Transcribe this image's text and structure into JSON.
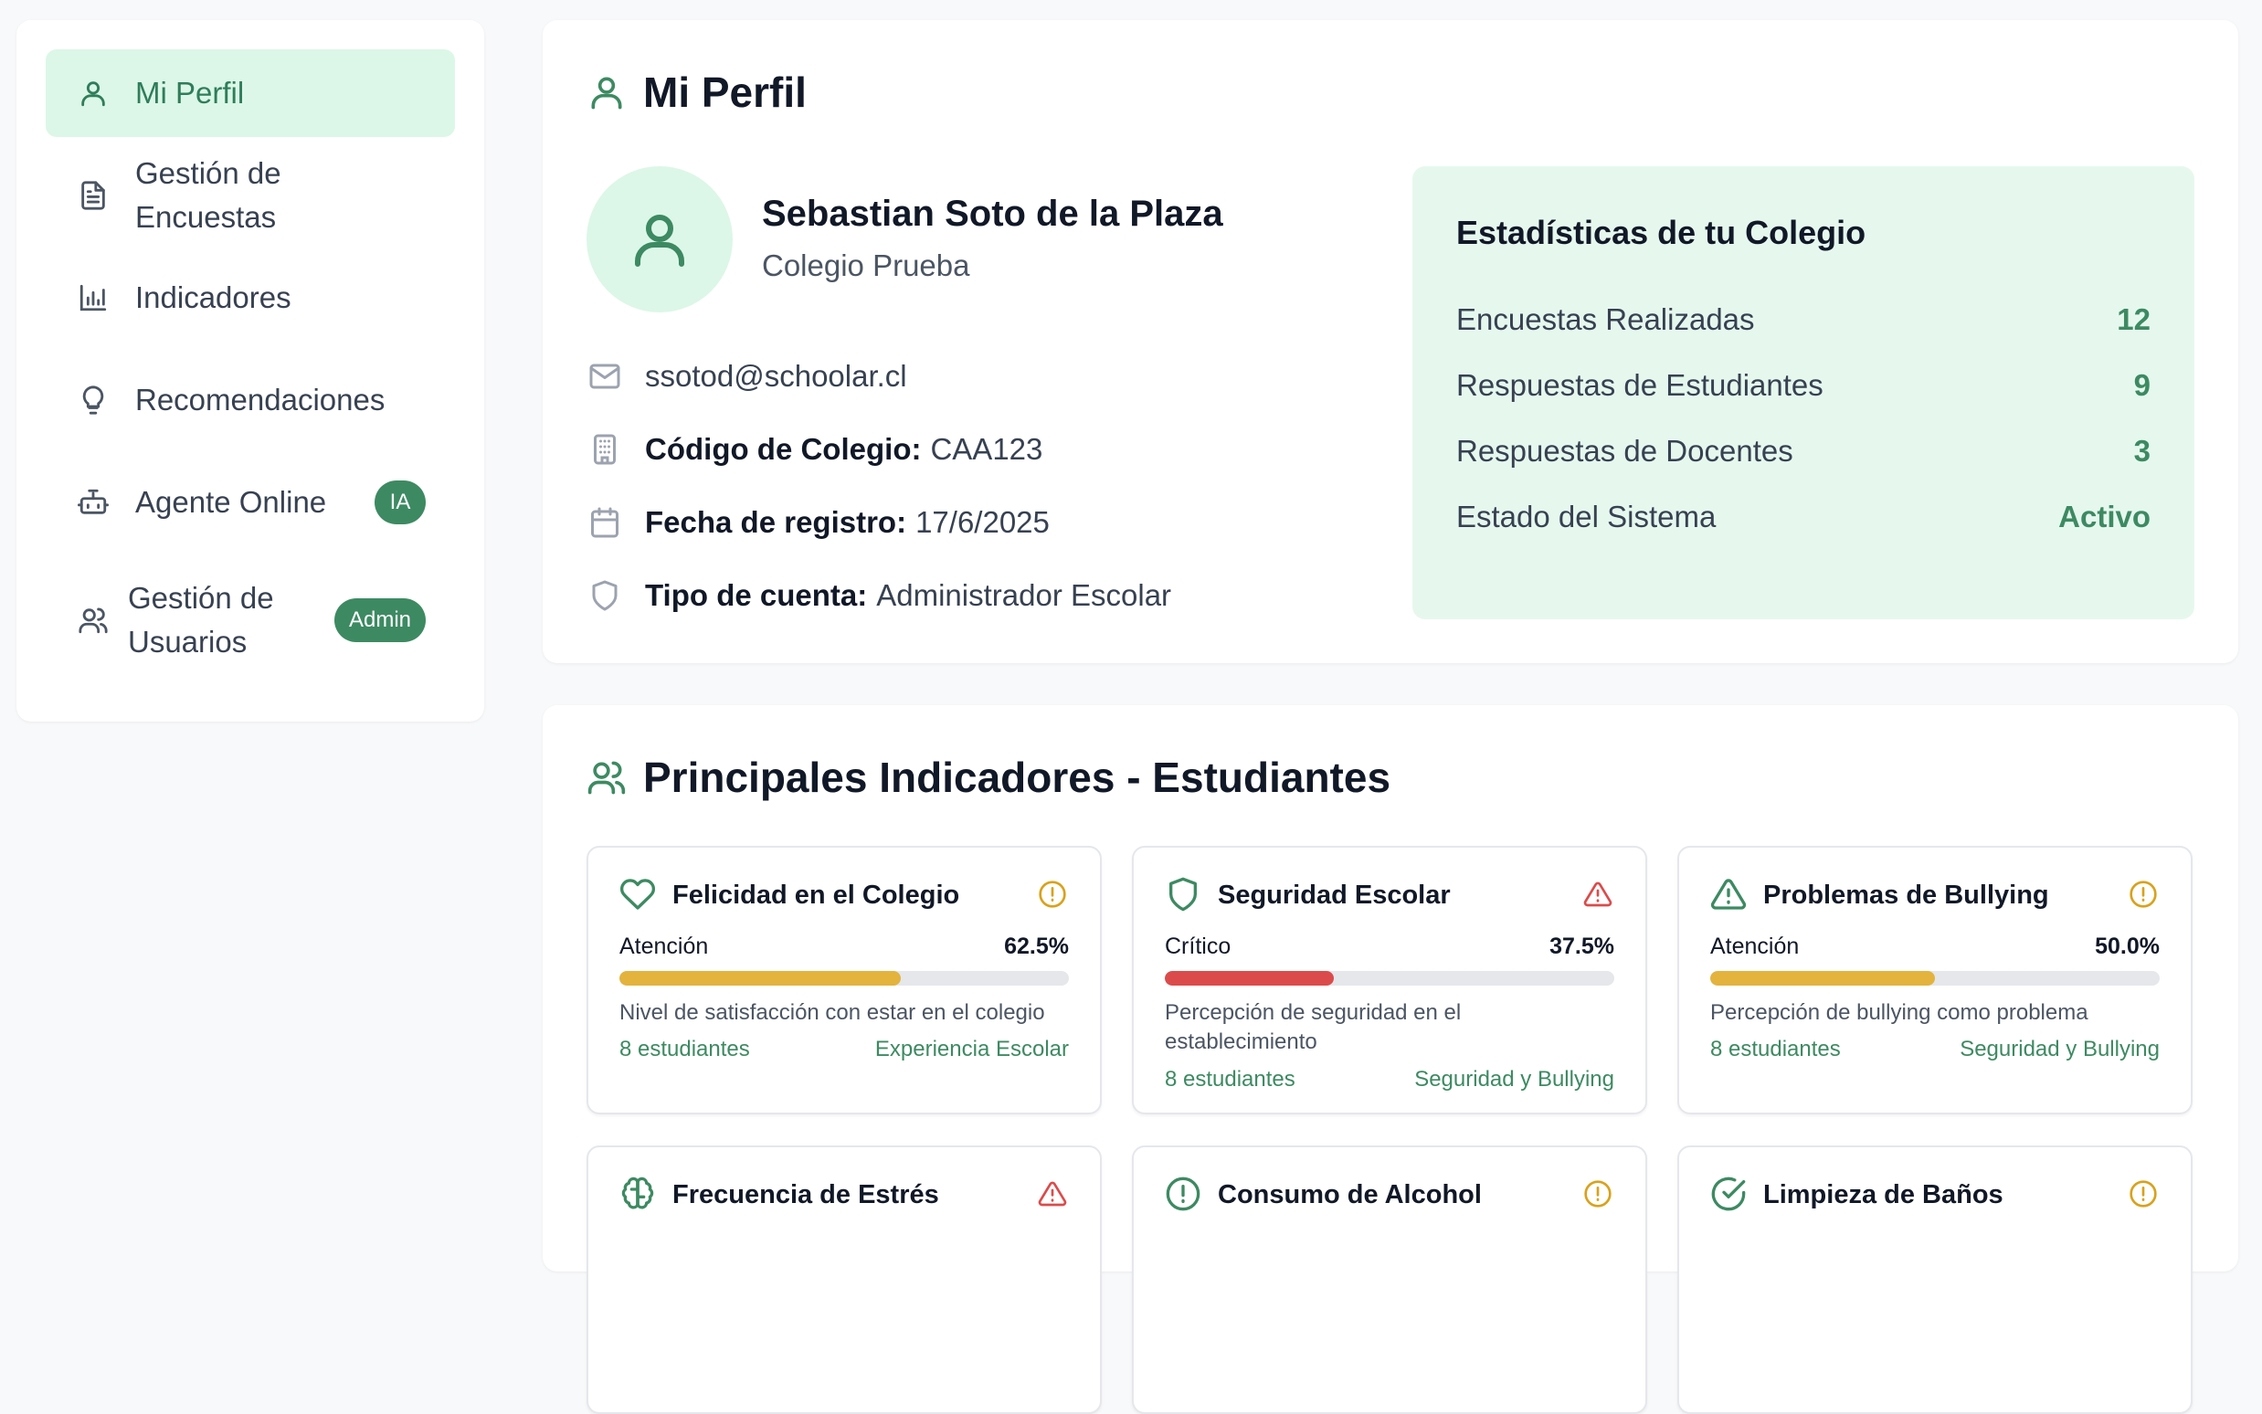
{
  "sidebar": {
    "items": [
      {
        "label": "Mi Perfil",
        "icon": "user-icon",
        "active": true
      },
      {
        "label": "Gestión de Encuestas",
        "icon": "file-text-icon"
      },
      {
        "label": "Indicadores",
        "icon": "bar-chart-icon"
      },
      {
        "label": "Recomendaciones",
        "icon": "lightbulb-icon"
      },
      {
        "label": "Agente Online",
        "icon": "bot-icon",
        "badge": "IA"
      },
      {
        "label": "Gestión de Usuarios",
        "icon": "users-icon",
        "badge": "Admin"
      }
    ]
  },
  "profile": {
    "title": "Mi Perfil",
    "name": "Sebastian Soto de la Plaza",
    "school": "Colegio Prueba",
    "email": "ssotod@schoolar.cl",
    "code_label": "Código de Colegio:",
    "code_value": "CAA123",
    "date_label": "Fecha de registro:",
    "date_value": "17/6/2025",
    "type_label": "Tipo de cuenta:",
    "type_value": "Administrador Escolar"
  },
  "stats": {
    "title": "Estadísticas de tu Colegio",
    "rows": [
      {
        "label": "Encuestas Realizadas",
        "value": "12"
      },
      {
        "label": "Respuestas de Estudiantes",
        "value": "9"
      },
      {
        "label": "Respuestas de Docentes",
        "value": "3"
      },
      {
        "label": "Estado del Sistema",
        "value": "Activo"
      }
    ]
  },
  "indicators": {
    "title": "Principales Indicadores - Estudiantes",
    "colors": {
      "warning": "#e3b33d",
      "critical": "#dc4b4b",
      "accent": "#3d8a62",
      "track": "#e5e7eb"
    },
    "cards": [
      {
        "title": "Felicidad en el Colegio",
        "icon": "heart-icon",
        "status_icon": "alert-circle-icon",
        "level": "Atención",
        "percent": "62.5%",
        "fill": 0.625,
        "severity": "warning",
        "description": "Nivel de satisfacción con estar en el colegio",
        "students": "8 estudiantes",
        "category": "Experiencia Escolar"
      },
      {
        "title": "Seguridad Escolar",
        "icon": "shield-icon",
        "status_icon": "alert-triangle-icon",
        "level": "Crítico",
        "percent": "37.5%",
        "fill": 0.375,
        "severity": "critical",
        "description": "Percepción de seguridad en el establecimiento",
        "students": "8 estudiantes",
        "category": "Seguridad y Bullying"
      },
      {
        "title": "Problemas de Bullying",
        "icon": "alert-triangle-icon",
        "status_icon": "alert-circle-icon",
        "level": "Atención",
        "percent": "50.0%",
        "fill": 0.5,
        "severity": "warning",
        "description": "Percepción de bullying como problema",
        "students": "8 estudiantes",
        "category": "Seguridad y Bullying"
      },
      {
        "title": "Frecuencia de Estrés",
        "icon": "brain-icon",
        "status_icon": "alert-triangle-icon"
      },
      {
        "title": "Consumo de Alcohol",
        "icon": "alert-circle-icon",
        "status_icon": "alert-circle-icon"
      },
      {
        "title": "Limpieza de Baños",
        "icon": "check-circle-icon",
        "status_icon": "alert-circle-icon"
      }
    ]
  }
}
